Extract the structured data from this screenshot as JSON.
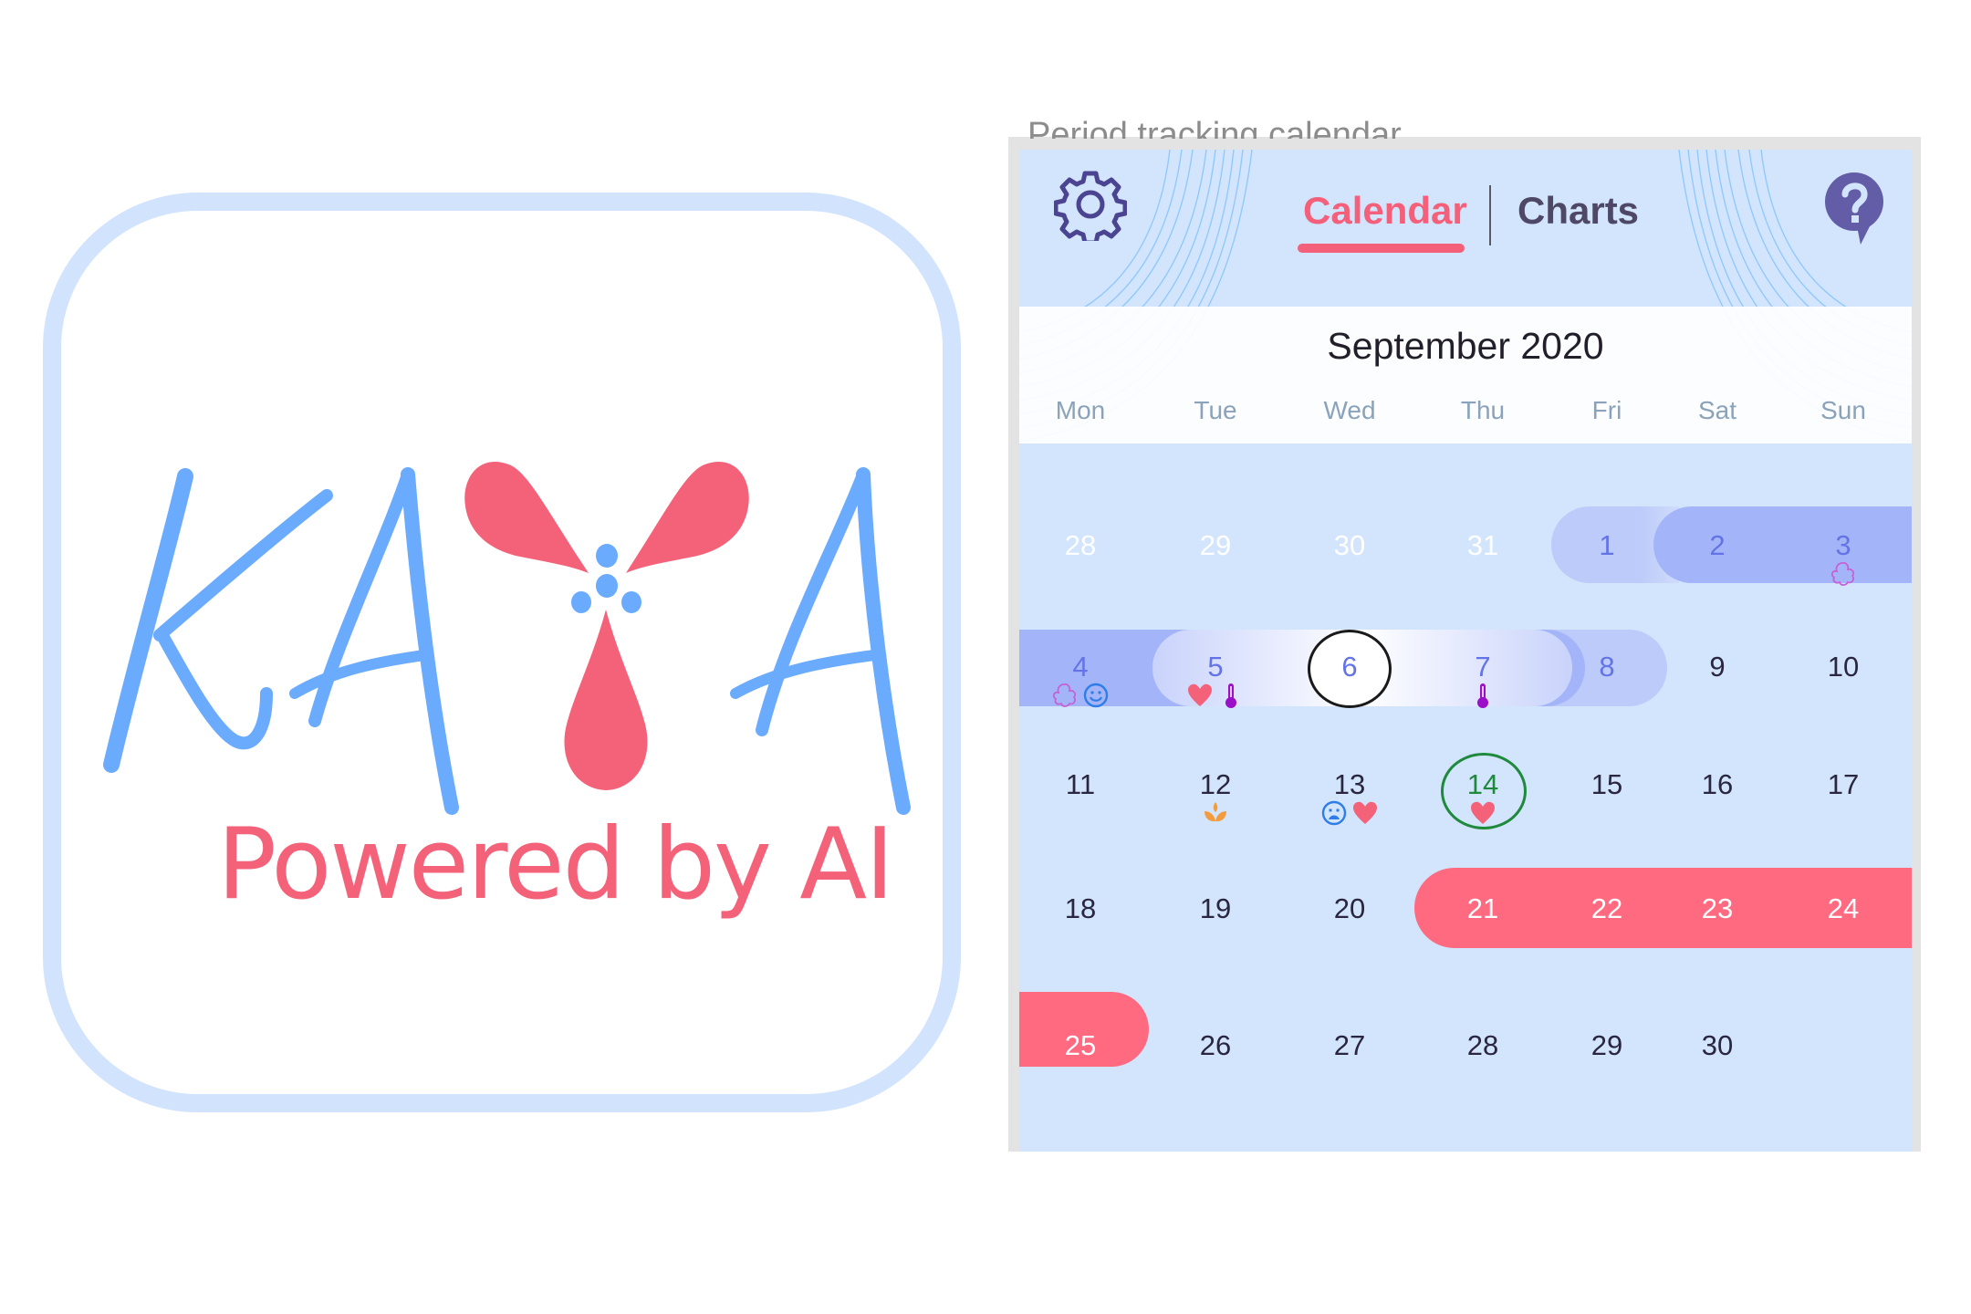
{
  "logo": {
    "brand": "KAYA",
    "tagline": "Powered by AI",
    "colors": {
      "letters": "#6aabfd",
      "petals": "#f4627a",
      "frame": "#d2e4fd"
    }
  },
  "panel": {
    "caption": "Period tracking calendar"
  },
  "app": {
    "tabs": [
      {
        "label": "Calendar",
        "active": true
      },
      {
        "label": "Charts",
        "active": false
      }
    ],
    "settings_icon": "gear-icon",
    "help_icon": "help-bubble-icon",
    "month_title": "September 2020",
    "weekdays": [
      "Mon",
      "Tue",
      "Wed",
      "Thu",
      "Fri",
      "Sat",
      "Sun"
    ],
    "colors": {
      "accent": "#f4607a",
      "period": "#ff6a80",
      "fertile_dark": "#a3b5f8",
      "fertile_light": "#bccbfa",
      "ovulation": "#1f8a3b",
      "background": "#d2e5fd"
    },
    "weeks": [
      [
        {
          "day": "28",
          "state": "muted"
        },
        {
          "day": "29",
          "state": "muted"
        },
        {
          "day": "30",
          "state": "muted"
        },
        {
          "day": "31",
          "state": "muted"
        },
        {
          "day": "1",
          "state": "fertile"
        },
        {
          "day": "2",
          "state": "fertile"
        },
        {
          "day": "3",
          "state": "fertile",
          "icons": [
            "symptom-blob-icon"
          ]
        }
      ],
      [
        {
          "day": "4",
          "state": "fertile",
          "icons": [
            "symptom-blob-icon",
            "happy-mood-icon"
          ]
        },
        {
          "day": "5",
          "state": "fertile",
          "icons": [
            "heart-icon",
            "thermometer-icon"
          ]
        },
        {
          "day": "6",
          "state": "fertile",
          "selected": true
        },
        {
          "day": "7",
          "state": "fertile",
          "icons": [
            "thermometer-icon"
          ]
        },
        {
          "day": "8",
          "state": "fertile"
        },
        {
          "day": "9",
          "state": "normal"
        },
        {
          "day": "10",
          "state": "normal"
        }
      ],
      [
        {
          "day": "11",
          "state": "normal"
        },
        {
          "day": "12",
          "state": "normal",
          "icons": [
            "lotus-icon"
          ]
        },
        {
          "day": "13",
          "state": "normal",
          "icons": [
            "sad-mood-icon",
            "heart-icon"
          ]
        },
        {
          "day": "14",
          "state": "ovulation",
          "today": true,
          "icons": [
            "heart-icon"
          ]
        },
        {
          "day": "15",
          "state": "normal"
        },
        {
          "day": "16",
          "state": "normal"
        },
        {
          "day": "17",
          "state": "normal"
        }
      ],
      [
        {
          "day": "18",
          "state": "normal"
        },
        {
          "day": "19",
          "state": "normal"
        },
        {
          "day": "20",
          "state": "normal"
        },
        {
          "day": "21",
          "state": "period"
        },
        {
          "day": "22",
          "state": "period"
        },
        {
          "day": "23",
          "state": "period"
        },
        {
          "day": "24",
          "state": "period"
        }
      ],
      [
        {
          "day": "25",
          "state": "period"
        },
        {
          "day": "26",
          "state": "normal"
        },
        {
          "day": "27",
          "state": "normal"
        },
        {
          "day": "28",
          "state": "normal"
        },
        {
          "day": "29",
          "state": "normal"
        },
        {
          "day": "30",
          "state": "normal"
        },
        {
          "day": "",
          "state": "empty"
        }
      ]
    ]
  }
}
